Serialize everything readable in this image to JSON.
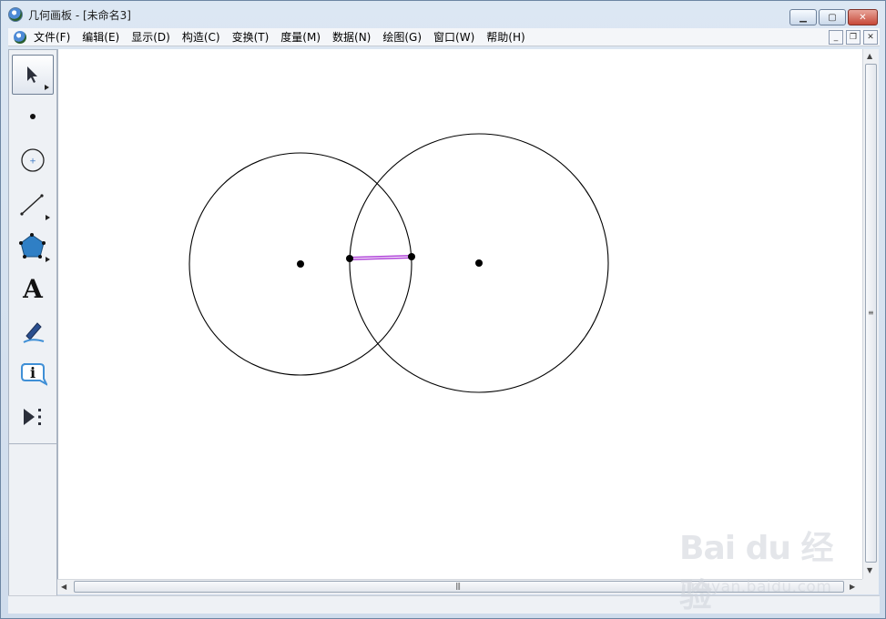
{
  "window": {
    "title": "几何画板 - [未命名3]",
    "controls": {
      "minimize": "▁",
      "maximize": "▢",
      "close": "✕"
    }
  },
  "menubar": {
    "items": [
      "文件(F)",
      "编辑(E)",
      "显示(D)",
      "构造(C)",
      "变换(T)",
      "度量(M)",
      "数据(N)",
      "绘图(G)",
      "窗口(W)",
      "帮助(H)"
    ],
    "mdi_controls": {
      "minimize": "_",
      "restore": "❐",
      "close": "✕"
    }
  },
  "toolbox": {
    "tools": [
      {
        "name": "arrow-select-tool",
        "icon": "arrow-icon",
        "selected": true
      },
      {
        "name": "point-tool",
        "icon": "point-icon",
        "selected": false
      },
      {
        "name": "compass-tool",
        "icon": "circle-icon",
        "selected": false
      },
      {
        "name": "straightedge-tool",
        "icon": "segment-icon",
        "selected": false
      },
      {
        "name": "polygon-tool",
        "icon": "polygon-icon",
        "selected": false
      },
      {
        "name": "text-tool",
        "icon": "text-A-icon",
        "selected": false,
        "glyph": "A"
      },
      {
        "name": "marker-tool",
        "icon": "marker-icon",
        "selected": false
      },
      {
        "name": "information-tool",
        "icon": "info-icon",
        "selected": false,
        "glyph": "i"
      },
      {
        "name": "custom-tool",
        "icon": "custom-tool-icon",
        "selected": false
      }
    ]
  },
  "canvas": {
    "colors": {
      "stroke": "#000000",
      "segment": "#b044d9",
      "point": "#000000"
    }
  },
  "scrollbars": {
    "grip": "≡",
    "h_grip": "|||"
  },
  "watermark": {
    "logo": "Bai du 经验",
    "sub": "jingyan.baidu.com"
  }
}
